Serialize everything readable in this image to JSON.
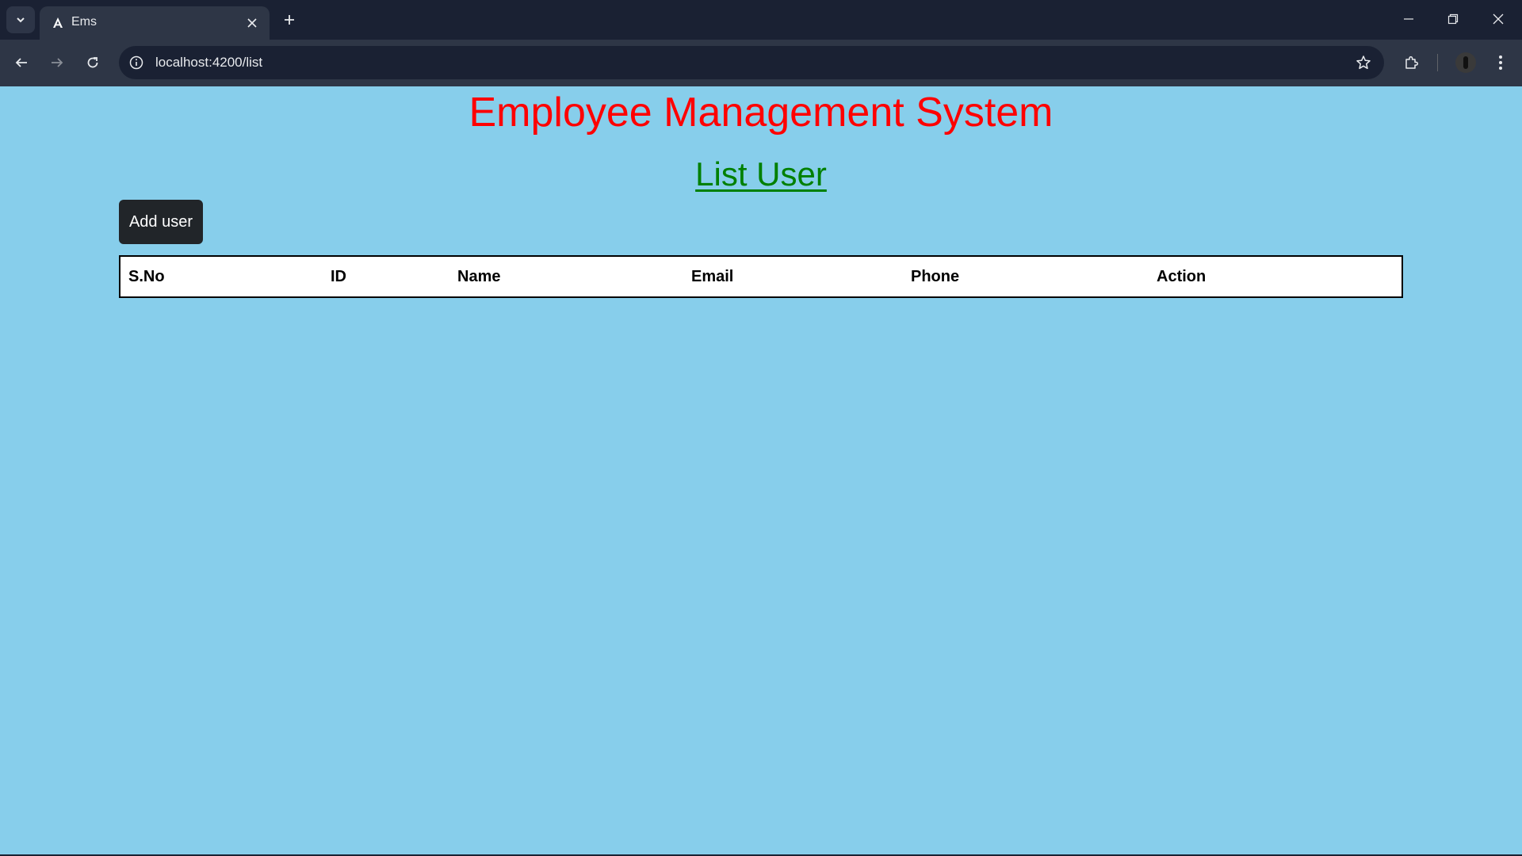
{
  "browser": {
    "tab_title": "Ems",
    "url": "localhost:4200/list",
    "icons": {
      "tab_search": "chevron-down-icon",
      "favicon": "angular-icon",
      "tab_close": "close-icon",
      "new_tab": "plus-icon",
      "back": "arrow-left-icon",
      "forward": "arrow-right-icon",
      "reload": "reload-icon",
      "site_info": "info-icon",
      "bookmark": "star-icon",
      "extensions": "puzzle-icon",
      "menu": "kebab-menu-icon",
      "minimize": "minimize-icon",
      "restore": "restore-icon",
      "close_window": "close-icon"
    }
  },
  "page": {
    "title": "Employee Management System",
    "subtitle": "List User",
    "add_button_label": "Add user",
    "table": {
      "columns": [
        "S.No",
        "ID",
        "Name",
        "Email",
        "Phone",
        "Action"
      ],
      "rows": []
    }
  },
  "colors": {
    "page_background": "#87ceeb",
    "title": "#ff0000",
    "subtitle": "#008000",
    "button_background": "#212529",
    "chrome_background": "#1a2133"
  }
}
